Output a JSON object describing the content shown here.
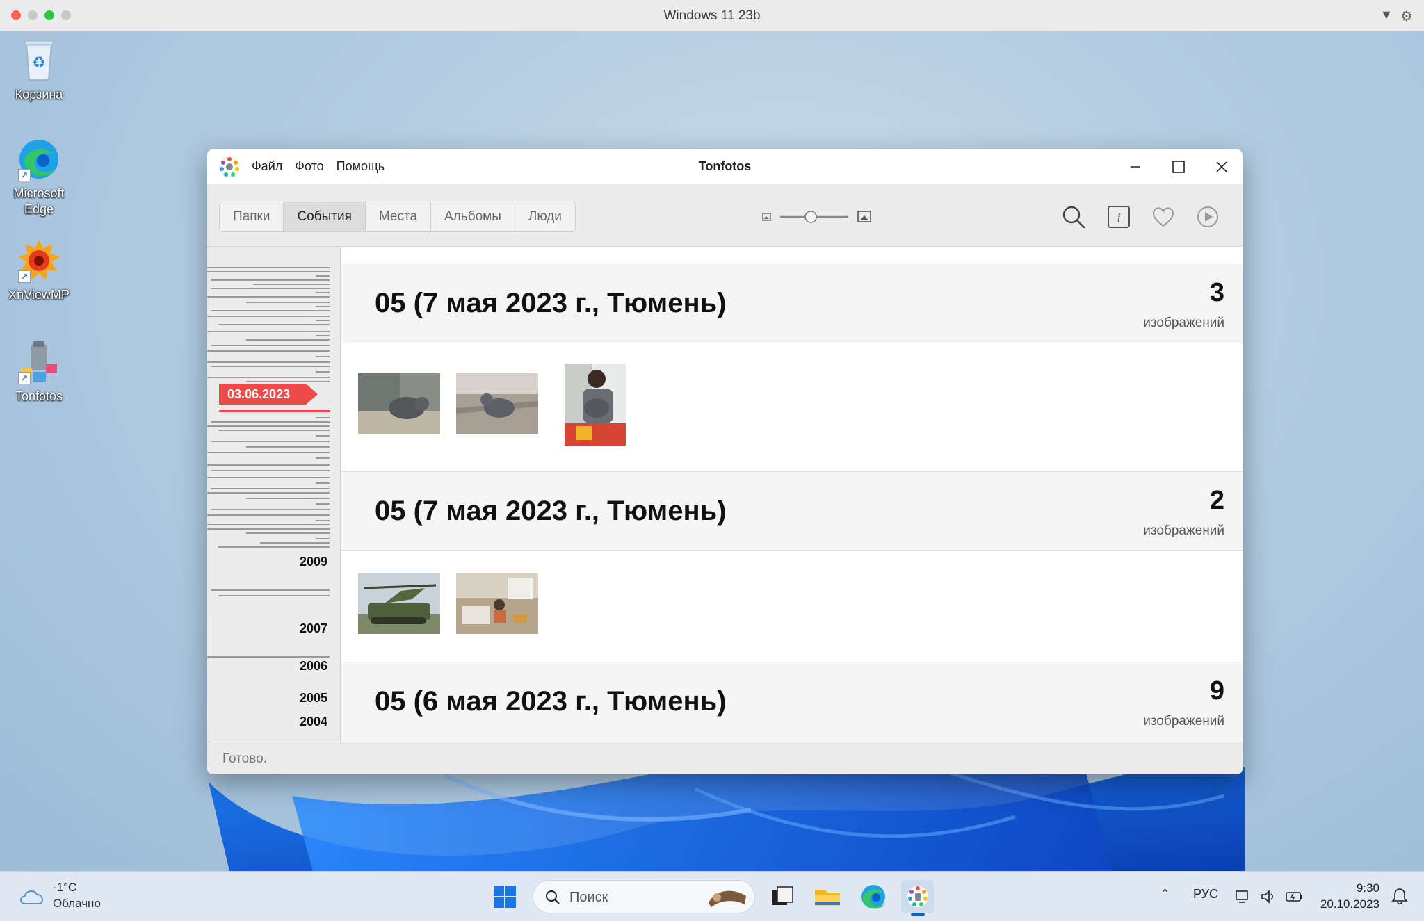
{
  "host": {
    "title": "Windows 11 23b"
  },
  "desktop": {
    "icons": [
      {
        "label": "Корзина"
      },
      {
        "label": "Microsoft Edge"
      },
      {
        "label": "XnViewMP"
      },
      {
        "label": "Tonfotos"
      }
    ]
  },
  "app": {
    "title": "Tonfotos",
    "menu": [
      "Файл",
      "Фото",
      "Помощь"
    ],
    "tabs": [
      {
        "label": "Папки",
        "active": false
      },
      {
        "label": "События",
        "active": true
      },
      {
        "label": "Места",
        "active": false
      },
      {
        "label": "Альбомы",
        "active": false
      },
      {
        "label": "Люди",
        "active": false
      }
    ],
    "zoom_level": 0.45,
    "tools": [
      "search-icon",
      "info-icon",
      "heart-icon",
      "play-icon"
    ],
    "timeline": {
      "selected_date": "03.06.2023",
      "years": [
        "2009",
        "2007",
        "2006",
        "2005",
        "2004"
      ]
    },
    "events": [
      {
        "title": "05 (7 мая 2023 г., Тюмень)",
        "count": "3",
        "unit": "изображений"
      },
      {
        "title": "05 (7 мая 2023 г., Тюмень)",
        "count": "2",
        "unit": "изображений"
      },
      {
        "title": "05 (6 мая 2023 г., Тюмень)",
        "count": "9",
        "unit": "изображений"
      }
    ],
    "status": "Готово."
  },
  "taskbar": {
    "weather_temp": "-1°C",
    "weather_desc": "Облачно",
    "search_placeholder": "Поиск",
    "lang": "РУС",
    "time": "9:30",
    "date": "20.10.2023"
  },
  "colors": {
    "accent": "#ef4a4a",
    "win_blue": "#0a63d6"
  }
}
